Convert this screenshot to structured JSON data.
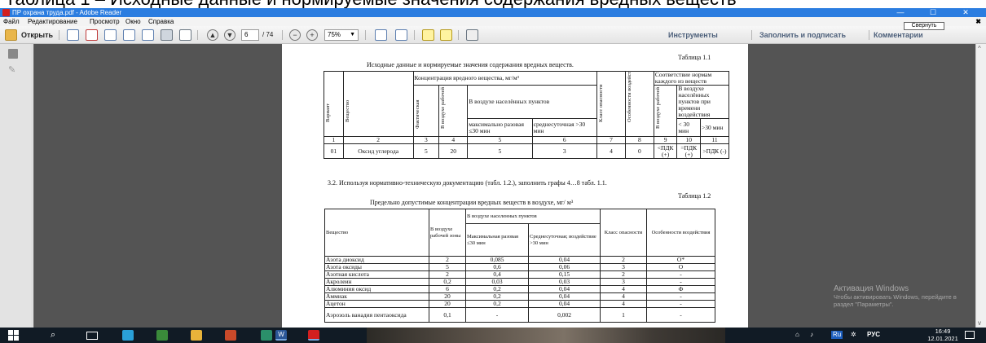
{
  "overlay_text": "Таблица 1 – Исходные данные и нормируемые значения содержания вредных веществ",
  "window": {
    "title": "ПР охрана труда.pdf - Adobe Reader",
    "minimize": "—",
    "maximize": "☐",
    "close": "✕"
  },
  "menu": {
    "items": [
      "Файл",
      "Редактирование",
      "Просмотр",
      "Окно",
      "Справка"
    ],
    "pin": "✖"
  },
  "collapse_button": "Свернуть",
  "toolbar": {
    "open_label": "Открыть",
    "page_current": "6",
    "page_total": "/ 74",
    "zoom": "75%",
    "tools": "Инструменты",
    "fill_sign": "Заполнить и подписать",
    "comments": "Комментарии"
  },
  "document": {
    "t1_caption": "Таблица 1.1",
    "t1_title": "Исходные данные и нормируемые значения содержания вредных веществ.",
    "t1": {
      "h_concentration": "Концентрация вредного вещества, мг/м³",
      "h_compliance": "Соответствие нормам каждого из веществ",
      "h_air_pop": "В воздухе населённых пунктов",
      "h_air_pop_time": "В воздухе населённых пунктов при времени воздействия",
      "h_max": "максимально разовая ≤30 мин",
      "h_avg": "среднесуточная >30 мин",
      "h_le30": "< 30 мин",
      "h_gt30": ">30 мин",
      "v_variant": "Вариант",
      "v_substance": "Вещество",
      "v_actual": "Фактическая",
      "v_workzone": "В воздухе рабочей зоны",
      "v_class": "Класс опасности",
      "v_features": "Особенности воздействия",
      "v_workzone2": "В воздухе рабочей зоны",
      "nums": [
        "1",
        "2",
        "3",
        "4",
        "5",
        "6",
        "7",
        "8",
        "9",
        "10",
        "11"
      ],
      "row": [
        "01",
        "Оксид углерода",
        "5",
        "20",
        "5",
        "3",
        "4",
        "0",
        "<ПДК (+)",
        "=ПДК (+)",
        ">ПДК (-)"
      ]
    },
    "para": "3.2. Используя нормативно-техническую документацию (табл. 1.2.), заполнить графы 4…8 табл. 1.1.",
    "t2_caption": "Таблица 1.2",
    "t2_title": "Предельно допустимые концентрации вредных веществ в воздухе, мг/ м³",
    "t2": {
      "h_substance": "Вещество",
      "h_workzone": "В воздухе рабочей зоны",
      "h_pop": "В воздухе населенных пунктов",
      "h_max": "Максимальная разовая ≤30 мин",
      "h_avg": "Среднесуточная; воздействие >30 мин",
      "h_class": "Класс опасности",
      "h_features": "Особенности воздействия",
      "rows": [
        [
          "Азота диоксид",
          "2",
          "0,085",
          "0,04",
          "2",
          "О*"
        ],
        [
          "Азота оксиды",
          "5",
          "0,6",
          "0,06",
          "3",
          "О"
        ],
        [
          "Азотная кислота",
          "2",
          "0,4",
          "0,15",
          "2",
          "-"
        ],
        [
          "Акролеин",
          "0,2",
          "0,03",
          "0,03",
          "3",
          "-"
        ],
        [
          "Алюминия оксид",
          "6",
          "0,2",
          "0,04",
          "4",
          "Ф"
        ],
        [
          "Аммиак",
          "20",
          "0,2",
          "0,04",
          "4",
          "-"
        ],
        [
          "Ацетон",
          "20",
          "0,2",
          "0,04",
          "4",
          "-"
        ],
        [
          "Аэрозоль ванадия пентаоксида",
          "0,1",
          "-",
          "0,002",
          "1",
          "-"
        ]
      ]
    }
  },
  "watermark": {
    "line1": "Активация Windows",
    "line2": "Чтобы активировать Windows, перейдите в",
    "line3": "раздел \"Параметры\"."
  },
  "tray": {
    "lang": "РУС",
    "time": "16:49",
    "date": "12.01.2021"
  }
}
